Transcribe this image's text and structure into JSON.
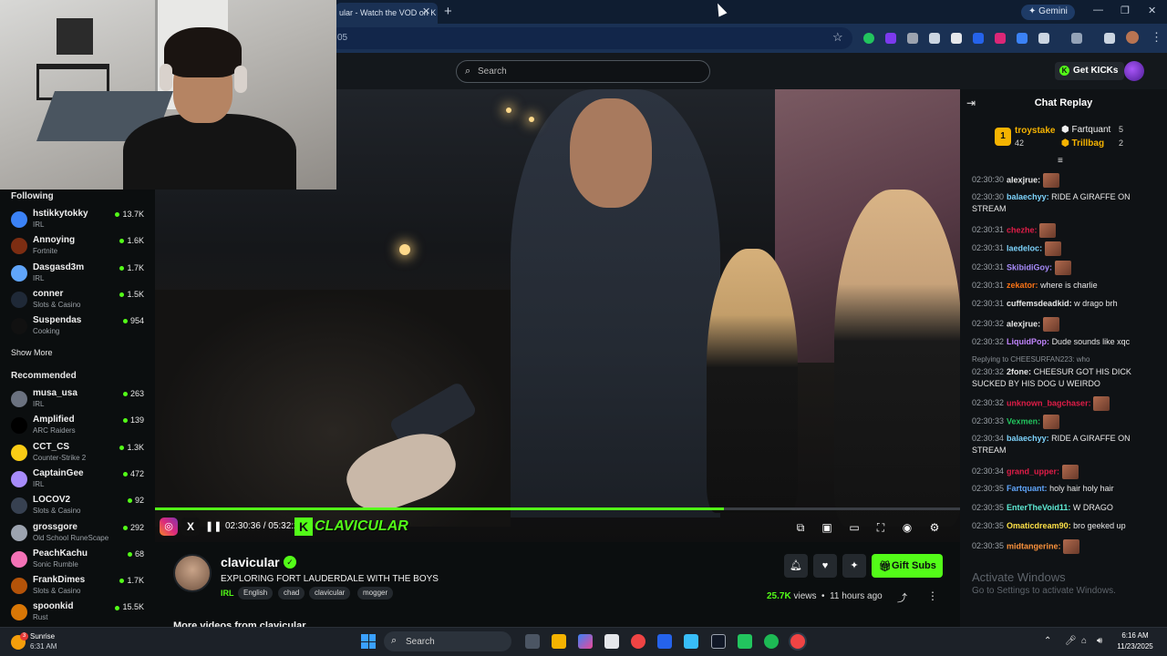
{
  "browser": {
    "tab_title": "ular - Watch the VOD on K",
    "url_fragment": "05",
    "gemini_label": "Gemini"
  },
  "kick": {
    "search_placeholder": "Search",
    "get_kicks_label": "Get KICKs"
  },
  "sidebar": {
    "following_heading": "Following",
    "following": [
      {
        "name": "hstikkytokky",
        "category": "IRL",
        "viewers": "13.7K",
        "avatar_color": "#3b82f6"
      },
      {
        "name": "Annoying",
        "category": "Fortnite",
        "viewers": "1.6K",
        "avatar_color": "#7c2d12"
      },
      {
        "name": "Dasgasd3m",
        "category": "IRL",
        "viewers": "1.7K",
        "avatar_color": "#60a5fa"
      },
      {
        "name": "conner",
        "category": "Slots & Casino",
        "viewers": "1.5K",
        "avatar_color": "#1f2937"
      },
      {
        "name": "Suspendas",
        "category": "Cooking",
        "viewers": "954",
        "avatar_color": "#111111"
      }
    ],
    "show_more": "Show More",
    "recommended_heading": "Recommended",
    "recommended": [
      {
        "name": "musa_usa",
        "category": "IRL",
        "viewers": "263",
        "avatar_color": "#6b7280"
      },
      {
        "name": "Amplified",
        "category": "ARC Raiders",
        "viewers": "139",
        "avatar_color": "#000000"
      },
      {
        "name": "CCT_CS",
        "category": "Counter-Strike 2",
        "viewers": "1.3K",
        "avatar_color": "#facc15"
      },
      {
        "name": "CaptainGee",
        "category": "IRL",
        "viewers": "472",
        "avatar_color": "#a78bfa"
      },
      {
        "name": "LOCOV2",
        "category": "Slots & Casino",
        "viewers": "92",
        "avatar_color": "#374151"
      },
      {
        "name": "grossgore",
        "category": "Old School RuneScape",
        "viewers": "292",
        "avatar_color": "#9ca3af"
      },
      {
        "name": "PeachKachu",
        "category": "Sonic Rumble",
        "viewers": "68",
        "avatar_color": "#f472b6"
      },
      {
        "name": "FrankDimes",
        "category": "Slots & Casino",
        "viewers": "1.7K",
        "avatar_color": "#b45309"
      },
      {
        "name": "spoonkid",
        "category": "Rust",
        "viewers": "15.5K",
        "avatar_color": "#d97706"
      }
    ]
  },
  "player": {
    "time_display": "02:30:36 / 05:32:28",
    "progress": 0.707,
    "brand_text": "CLAVICULAR"
  },
  "channel": {
    "name": "clavicular",
    "stream_title": "EXPLORING FORT LAUDERDALE WITH THE BOYS",
    "category": "IRL",
    "tags": [
      "English",
      "chad",
      "clavicular",
      "mogger"
    ],
    "gift_subs_label": "Gift Subs",
    "views_count": "25.7K",
    "views_word": "views",
    "age": "11 hours ago",
    "more_videos": "More videos from clavicular"
  },
  "chat": {
    "title": "Chat Replay",
    "leaders": [
      {
        "rank": "1",
        "name": "troystake",
        "count": "42"
      },
      {
        "name": "Fartquant",
        "count": "5"
      },
      {
        "name": "Trillbag",
        "count": "2"
      }
    ],
    "reply_note": "Replying to CHEESURFAN223: who",
    "messages": [
      {
        "ts": "02:30:30",
        "user": "alexjrue:",
        "color": "#e8e8e8",
        "text": "",
        "emote": true
      },
      {
        "ts": "02:30:30",
        "user": "balaechyy:",
        "color": "#7dd3fc",
        "text": "RIDE A GIRAFFE ON STREAM",
        "emote": false
      },
      {
        "ts": "02:30:31",
        "user": "chezhe:",
        "color": "#e11d48",
        "text": "",
        "emote": true
      },
      {
        "ts": "02:30:31",
        "user": "laedeloc:",
        "color": "#7dd3fc",
        "text": "",
        "emote": true
      },
      {
        "ts": "02:30:31",
        "user": "SkibidiGoy:",
        "color": "#a78bfa",
        "text": "",
        "emote": true
      },
      {
        "ts": "02:30:31",
        "user": "zekator:",
        "color": "#f97316",
        "text": "where is charlie",
        "emote": false
      },
      {
        "ts": "02:30:31",
        "user": "cuffemsdeadkid:",
        "color": "#e8e8e8",
        "text": "w drago brh",
        "emote": false
      },
      {
        "ts": "02:30:32",
        "user": "alexjrue:",
        "color": "#e8e8e8",
        "text": "",
        "emote": true
      },
      {
        "ts": "02:30:32",
        "user": "LiquidPop:",
        "color": "#c084fc",
        "text": "Dude sounds like xqc",
        "emote": false
      },
      {
        "ts": "02:30:32",
        "user": "2fone:",
        "color": "#e8e8e8",
        "text": "CHEESUR GOT HIS DICK SUCKED BY HIS DOG U WEIRDO",
        "emote": false
      },
      {
        "ts": "02:30:32",
        "user": "unknown_bagchaser:",
        "color": "#e11d48",
        "text": "",
        "emote": true
      },
      {
        "ts": "02:30:33",
        "user": "Vexmen:",
        "color": "#22c55e",
        "text": "",
        "emote": true
      },
      {
        "ts": "02:30:34",
        "user": "balaechyy:",
        "color": "#7dd3fc",
        "text": "RIDE A GIRAFFE ON STREAM",
        "emote": false
      },
      {
        "ts": "02:30:34",
        "user": "grand_upper:",
        "color": "#e11d48",
        "text": "",
        "emote": true
      },
      {
        "ts": "02:30:35",
        "user": "Fartquant:",
        "color": "#60a5fa",
        "text": "holy hair holy hair",
        "emote": false
      },
      {
        "ts": "02:30:35",
        "user": "EnterTheVoid11:",
        "color": "#5eead4",
        "text": "W DRAGO",
        "emote": false
      },
      {
        "ts": "02:30:35",
        "user": "Omaticdream90:",
        "color": "#fde047",
        "text": "bro geeked up",
        "emote": false
      },
      {
        "ts": "02:30:35",
        "user": "midtangerine:",
        "color": "#fb923c",
        "text": "",
        "emote": true
      }
    ]
  },
  "watermark": {
    "line1": "Activate Windows",
    "line2": "Go to Settings to activate Windows."
  },
  "taskbar": {
    "weather_title": "Sunrise",
    "weather_time": "6:31 AM",
    "weather_badge": "3",
    "search_label": "Search",
    "clock_time": "6:16 AM",
    "clock_date": "11/23/2025"
  },
  "colors": {
    "kick_green": "#53fc18",
    "chrome_bg": "#0f1d31",
    "page_bg": "#0b0e0f"
  }
}
